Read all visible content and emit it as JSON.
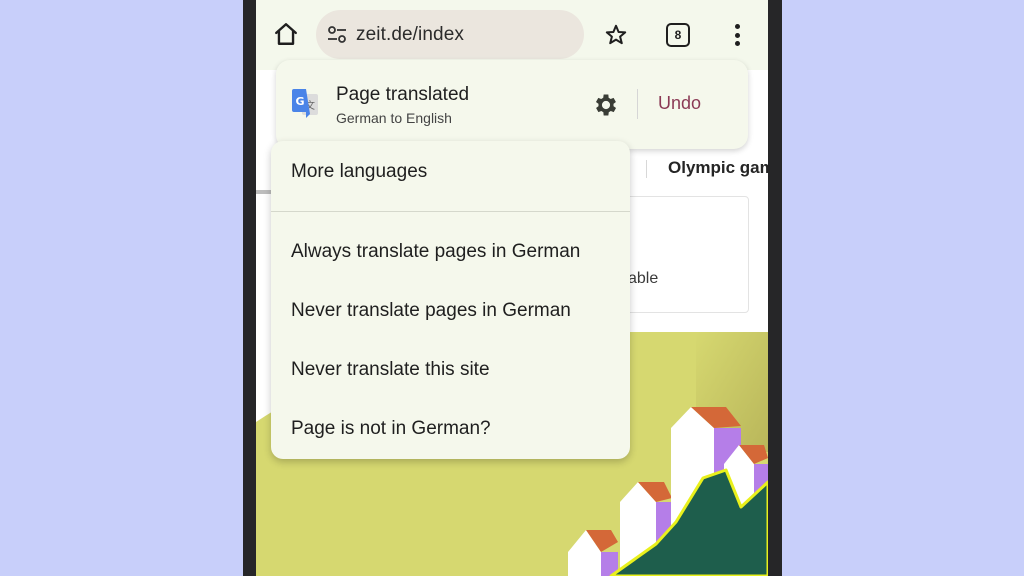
{
  "toolbar": {
    "url": "zeit.de/index",
    "tab_count": "8",
    "icons": {
      "home": "home-icon",
      "site_settings": "tune-icon",
      "bookmark": "star-outline-icon",
      "tabs": "tab-switcher-icon",
      "menu": "more-vert-icon"
    }
  },
  "background_page": {
    "nav_item": "Olympic gam",
    "card_text": "able"
  },
  "translate_bubble": {
    "title": "Page translated",
    "subtitle": "German to English",
    "undo_label": "Undo",
    "icons": {
      "translate": "google-translate-icon",
      "settings": "gear-icon"
    },
    "colors": {
      "undo": "#8b3a55",
      "background": "#f5f8ec"
    }
  },
  "dropdown_menu": {
    "items": [
      {
        "label": "More languages"
      },
      {
        "label": "Always translate pages in German"
      },
      {
        "label": "Never translate pages in German"
      },
      {
        "label": "Never translate this site"
      },
      {
        "label": "Page is not in German?"
      }
    ]
  },
  "colors": {
    "backdrop": "#c8cffa",
    "phone_frame": "#262628",
    "hero_bg": "#d6d870",
    "hero_mountain": "#1e5e4c",
    "hero_outline": "#e9f01c"
  }
}
